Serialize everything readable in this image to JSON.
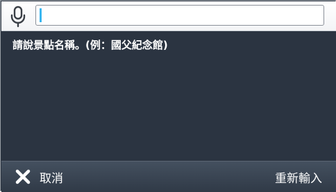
{
  "search": {
    "value": "",
    "placeholder": ""
  },
  "prompt": {
    "text": "請說景點名稱。(例：國父紀念館)"
  },
  "footer": {
    "cancel_label": "取消",
    "reenter_label": "重新輸入"
  },
  "icons": {
    "mic": "microphone-icon",
    "cancel": "close-icon"
  },
  "colors": {
    "background": "#2b3441",
    "caret": "#39b6f0",
    "text": "#ffffff"
  }
}
